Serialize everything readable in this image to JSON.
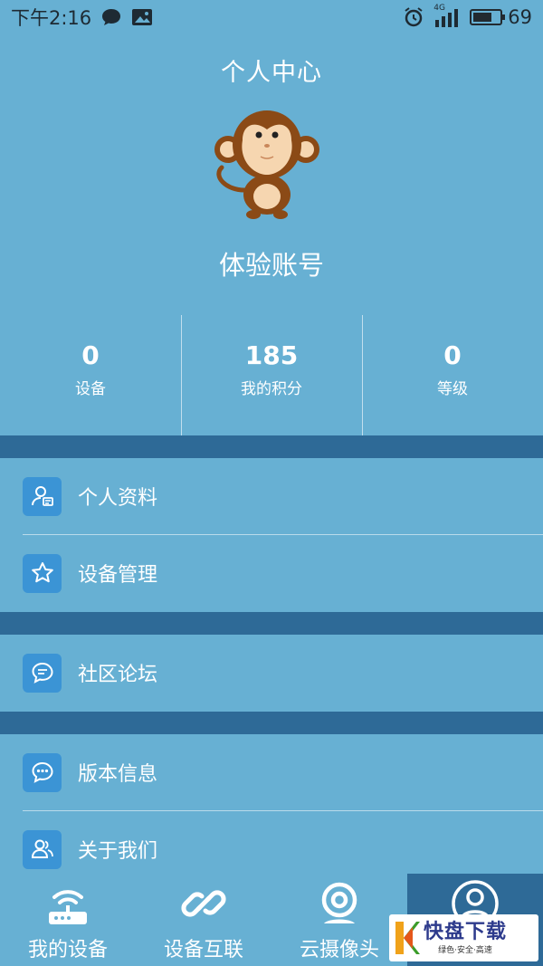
{
  "status_bar": {
    "time": "下午2:16",
    "network": "4G",
    "battery": "69",
    "battery_level": 0.69
  },
  "header": {
    "title": "个人中心",
    "account_name": "体验账号"
  },
  "stats": [
    {
      "value": "0",
      "label": "设备"
    },
    {
      "value": "185",
      "label": "我的积分"
    },
    {
      "value": "0",
      "label": "等级"
    }
  ],
  "menu": {
    "profile": {
      "label": "个人资料",
      "icon": "person-card-icon"
    },
    "device_manage": {
      "label": "设备管理",
      "icon": "star-icon"
    },
    "forum": {
      "label": "社区论坛",
      "icon": "chat-bubble-icon"
    },
    "version": {
      "label": "版本信息",
      "icon": "message-dots-icon"
    },
    "about": {
      "label": "关于我们",
      "icon": "users-icon"
    }
  },
  "bottom_nav": [
    {
      "label": "我的设备",
      "icon": "router-icon"
    },
    {
      "label": "设备互联",
      "icon": "link-icon"
    },
    {
      "label": "云摄像头",
      "icon": "webcam-icon"
    },
    {
      "label": "",
      "icon": "user-icon"
    }
  ],
  "watermark": {
    "brand": "快盘下载",
    "tagline": "绿色·安全·高速"
  },
  "colors": {
    "background": "#67b0d3",
    "band": "#2e6a97",
    "icon_tile": "#3b94d5"
  }
}
